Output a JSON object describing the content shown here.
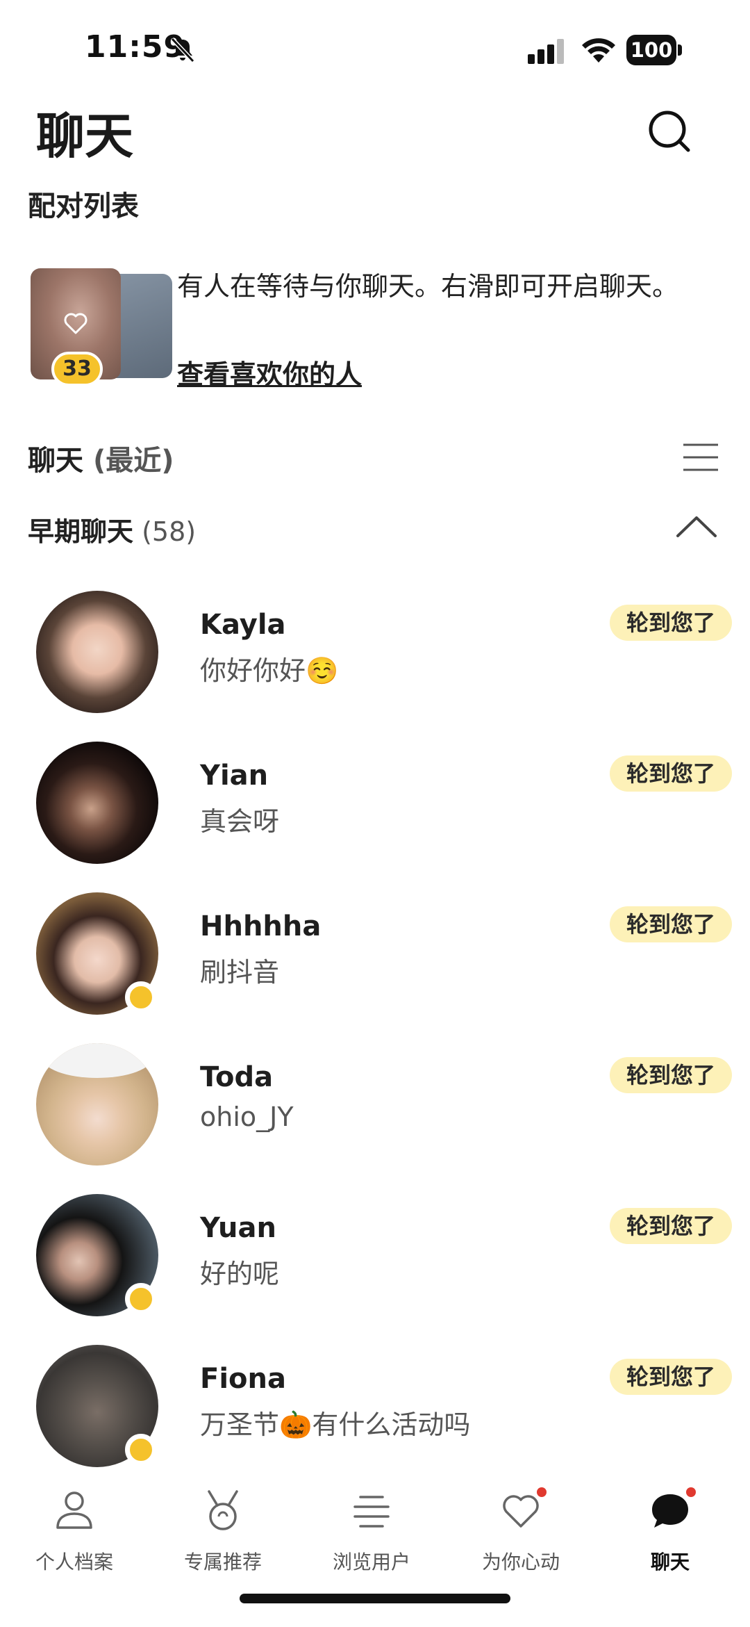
{
  "status_bar": {
    "time": "11:59",
    "battery": "100"
  },
  "header": {
    "title": "聊天"
  },
  "matches": {
    "section_title": "配对列表",
    "likes_count": "33",
    "likes_text": "有人在等待与你聊天。右滑即可开启聊天。",
    "likes_link": "查看喜欢你的人"
  },
  "chats": {
    "title": "聊天",
    "title_suffix": "(最近)",
    "early_title": "早期聊天",
    "early_count": "(58)",
    "items": [
      {
        "name": "Kayla",
        "message": "你好你好☺️",
        "badge": "轮到您了",
        "online": false
      },
      {
        "name": "Yian",
        "message": "真会呀",
        "badge": "轮到您了",
        "online": false
      },
      {
        "name": "Hhhhha",
        "message": "刷抖音",
        "badge": "轮到您了",
        "online": true
      },
      {
        "name": "Toda",
        "message": "ohio_JY",
        "badge": "轮到您了",
        "online": false
      },
      {
        "name": "Yuan",
        "message": "好的呢",
        "badge": "轮到您了",
        "online": true
      },
      {
        "name": "Fiona",
        "message": "万圣节🎃有什么活动吗",
        "badge": "轮到您了",
        "online": true
      }
    ]
  },
  "bottom_nav": {
    "items": [
      {
        "label": "个人档案",
        "icon": "profile-icon"
      },
      {
        "label": "专属推荐",
        "icon": "medal-icon"
      },
      {
        "label": "浏览用户",
        "icon": "browse-icon"
      },
      {
        "label": "为你心动",
        "icon": "heart-icon"
      },
      {
        "label": "聊天",
        "icon": "chat-bubble-icon"
      }
    ],
    "active": "聊天"
  },
  "colors": {
    "accent": "#f5c22b",
    "badge_bg": "#fdf1b8",
    "notification": "#e0392f"
  }
}
